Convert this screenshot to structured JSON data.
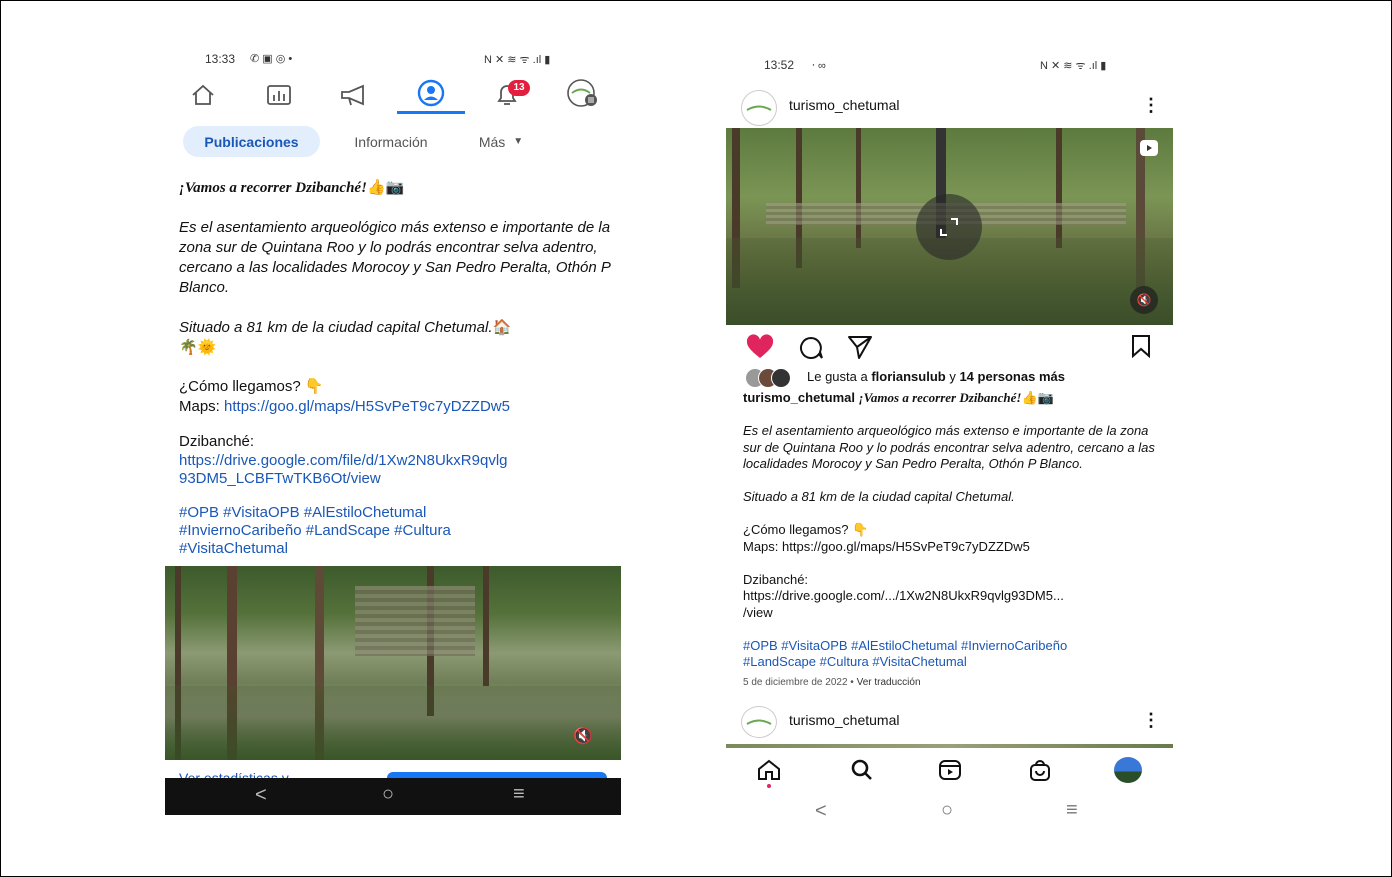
{
  "left_phone": {
    "status": {
      "time": "13:33",
      "left_icons": "✆ ▣ ◎ •",
      "right_icons": "N ✕ ≋ ᯤ .ıl ▮"
    },
    "nav": {
      "notification_count": "13"
    },
    "tabs": [
      {
        "label": "Publicaciones",
        "selected": true
      },
      {
        "label": "Información",
        "selected": false
      },
      {
        "label": "Más",
        "selected": false
      }
    ],
    "post": {
      "headline": "¡Vamos a recorrer Dzibanché!",
      "headline_emoji": "👍📷",
      "body_italic": "Es el asentamiento arqueológico más extenso e importante de la zona sur de Quintana Roo y lo podrás encontrar selva adentro, cercano a las localidades Morocoy y San Pedro Peralta, Othón P Blanco.",
      "location_line": "Situado a 81 km de la ciudad capital Chetumal.",
      "location_emoji": "🏠",
      "emoji_line": "🌴🌞",
      "question": "¿Cómo llegamos? 👇",
      "maps_label": "Maps: ",
      "maps_link": "https://goo.gl/maps/H5SvPeT9c7yDZZDw5",
      "dzibanche_label": "Dzibanché:",
      "drive_link_1": "https://drive.google.com/file/d/1Xw2N8UkxR9qvlg",
      "drive_link_2": "93DM5_LCBFTwTKB6Ot/view",
      "hashtags_1": "#OPB #VisitaOPB #AlEstiloChetumal",
      "hashtags_2": "#InviernoCaribeño #LandScape #Cultura",
      "hashtags_3": "#VisitaChetumal",
      "stats_cut_text": "Ver estadísticas y"
    },
    "system_nav": {
      "back": "<",
      "home": "○",
      "recents": "≡"
    }
  },
  "right_phone": {
    "status": {
      "time": "13:52",
      "left_icons": "⸱ ∞",
      "right_icons": "N ✕ ≋ ᯤ .ıl ▮"
    },
    "header": {
      "account": "turismo_chetumal",
      "menu": "⋮"
    },
    "likes": {
      "prefix": "Le gusta a ",
      "user": "floriansulub",
      "middle": " y ",
      "others": "14 personas más"
    },
    "caption": {
      "account": "turismo_chetumal",
      "headline": "¡Vamos a recorrer Dzibanché!",
      "headline_emoji": "👍📷",
      "body_italic": "Es el asentamiento arqueológico más extenso e importante de la zona sur de Quintana Roo y lo podrás encontrar selva adentro, cercano a las localidades Morocoy y San Pedro Peralta, Othón P Blanco.",
      "location_line": "Situado a 81 km de la ciudad capital Chetumal.",
      "question": "¿Cómo llegamos? 👇",
      "maps": "Maps: https://goo.gl/maps/H5SvPeT9c7yDZZDw5",
      "dzibanche_label": "Dzibanché:",
      "drive_1": "https://drive.google.com/.../1Xw2N8UkxR9qvlg93DM5...",
      "drive_2": "/view",
      "hashtags_1": "#OPB #VisitaOPB #AlEstiloChetumal #InviernoCaribeño",
      "hashtags_2": "#LandScape #Cultura #VisitaChetumal",
      "date": "5 de diciembre de 2022",
      "separator": " • ",
      "translate": "Ver traducción"
    },
    "next_post": {
      "account": "turismo_chetumal",
      "menu": "⋮"
    },
    "system_nav": {
      "back": "<",
      "home": "○",
      "recents": "≡"
    }
  },
  "colors": {
    "link": "#1a57b6",
    "like_red": "#e0245e",
    "tab_selected_bg": "#e3eefc",
    "tab_selected_text": "#1a57b6",
    "accent_blue": "#1877f2"
  }
}
